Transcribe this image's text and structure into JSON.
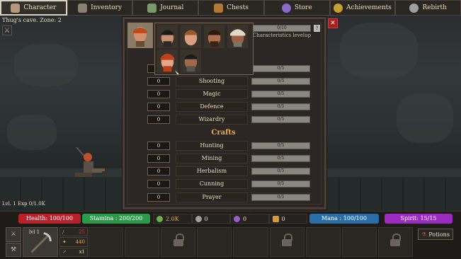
{
  "nav": {
    "tabs": [
      {
        "label": "Character",
        "icon": "character-icon",
        "color": "#b89878"
      },
      {
        "label": "Inventory",
        "icon": "backpack-icon",
        "color": "#8a8070"
      },
      {
        "label": "Journal",
        "icon": "quill-icon",
        "color": "#7a9a6a"
      },
      {
        "label": "Chests",
        "icon": "chest-icon",
        "color": "#b07830"
      },
      {
        "label": "Store",
        "icon": "gem-icon",
        "color": "#8a6ac8"
      },
      {
        "label": "Achievements",
        "icon": "medal-icon",
        "color": "#c8a030"
      },
      {
        "label": "Rebirth",
        "icon": "rebirth-icon",
        "color": "#a0a0a0"
      }
    ]
  },
  "scene": {
    "zone": "Thug's cave. Zone: 2",
    "level": "Lvl. 1 Exp 0/1.0K"
  },
  "panel": {
    "characteristics_bar": "0/10",
    "characteristics_label": "Characteristics levelup",
    "help": "?",
    "close": "✕",
    "skills": [
      {
        "name": "",
        "value": "0",
        "progress": "0/5"
      },
      {
        "name": "Shooting",
        "value": "0",
        "progress": "0/5"
      },
      {
        "name": "Magic",
        "value": "0",
        "progress": "0/5"
      },
      {
        "name": "Defence",
        "value": "0",
        "progress": "0/5"
      },
      {
        "name": "Wizardry",
        "value": "0",
        "progress": "0/5"
      }
    ],
    "crafts_title": "Crafts",
    "crafts": [
      {
        "name": "Hunting",
        "value": "0",
        "progress": "0/5"
      },
      {
        "name": "Mining",
        "value": "0",
        "progress": "0/5"
      },
      {
        "name": "Herbalism",
        "value": "0",
        "progress": "0/5"
      },
      {
        "name": "Cunning",
        "value": "0",
        "progress": "0/5"
      },
      {
        "name": "Prayer",
        "value": "0",
        "progress": "0/5"
      }
    ]
  },
  "status": {
    "health": "Health: 100/100",
    "stamina": "Stamina : 200/200",
    "mana": "Mana : 100/100",
    "spirit": "Spirit: 15/15",
    "resources": [
      {
        "value": "2.0K",
        "icon": "herb-icon",
        "color": "#6ab04a"
      },
      {
        "value": "0",
        "icon": "silver-coin-icon",
        "color": "#a0a0a0"
      },
      {
        "value": "0",
        "icon": "purple-gem-icon",
        "color": "#9a5ad0"
      },
      {
        "value": "0",
        "icon": "gold-bars-icon",
        "color": "#d89a30"
      }
    ],
    "weapon": {
      "level": "lvl 1",
      "stat1": "25",
      "stat2": "440",
      "stat3": "x1"
    },
    "potions": "Potions"
  },
  "colors": {
    "health": "#b8202a",
    "stamina": "#2a9a48",
    "mana": "#2a6ea8",
    "spirit": "#9a2ac0",
    "accent": "#e8a850"
  }
}
